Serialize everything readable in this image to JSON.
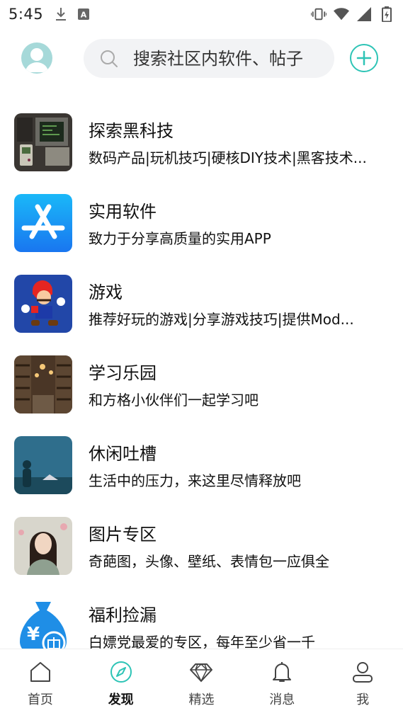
{
  "status_bar": {
    "time": "5:45",
    "left_icons": [
      "download-icon",
      "a-badge-icon"
    ],
    "right_icons": [
      "vibrate-icon",
      "wifi-icon",
      "signal-icon",
      "battery-icon"
    ]
  },
  "header": {
    "search": {
      "placeholder": "搜索社区内软件、帖子"
    },
    "accent_color": "#2ec4b6"
  },
  "communities": [
    {
      "title": "探索黑科技",
      "desc": "数码产品|玩机技巧|硬核DIY技术|黑客技术...",
      "icon": "retro-computer-thumbnail"
    },
    {
      "title": "实用软件",
      "desc": "致力于分享高质量的实用APP",
      "icon": "app-store-icon"
    },
    {
      "title": "游戏",
      "desc": "推荐好玩的游戏|分享游戏技巧|提供Mod...",
      "icon": "mario-thumbnail"
    },
    {
      "title": "学习乐园",
      "desc": "和方格小伙伴们一起学习吧",
      "icon": "library-thumbnail"
    },
    {
      "title": "休闲吐槽",
      "desc": "生活中的压力，来这里尽情释放吧",
      "icon": "silhouette-thumbnail"
    },
    {
      "title": "图片专区",
      "desc": "奇葩图，头像、壁纸、表情包一应俱全",
      "icon": "portrait-thumbnail"
    },
    {
      "title": "福利捡漏",
      "desc": "白嫖党最爱的专区，每年至少省一千",
      "icon": "money-bag-icon"
    }
  ],
  "tabs": [
    {
      "label": "首页",
      "icon": "home-icon",
      "active": false
    },
    {
      "label": "发现",
      "icon": "compass-icon",
      "active": true
    },
    {
      "label": "精选",
      "icon": "diamond-icon",
      "active": false
    },
    {
      "label": "消息",
      "icon": "bell-icon",
      "active": false
    },
    {
      "label": "我",
      "icon": "user-icon",
      "active": false
    }
  ]
}
